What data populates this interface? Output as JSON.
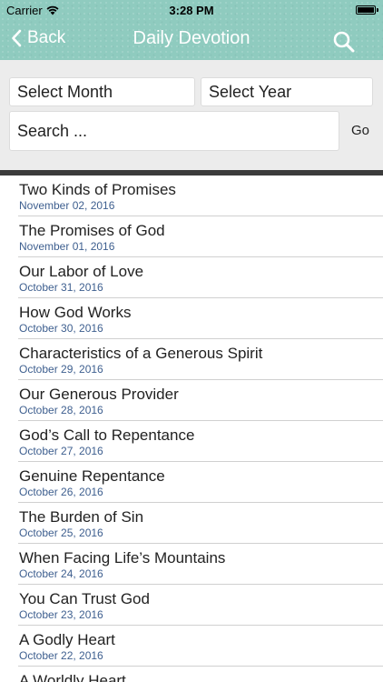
{
  "status_bar": {
    "carrier": "Carrier",
    "time": "3:28 PM",
    "battery_level": 1.0
  },
  "nav": {
    "back_label": "Back",
    "title": "Daily Devotion",
    "search_icon": "magnifier-icon"
  },
  "filters": {
    "month_label": "Select Month",
    "year_label": "Select Year",
    "search_placeholder": "Search ...",
    "go_label": "Go"
  },
  "devotions": [
    {
      "title": "Two Kinds of Promises",
      "date": "November 02, 2016"
    },
    {
      "title": "The Promises of God",
      "date": "November 01, 2016"
    },
    {
      "title": "Our Labor of Love",
      "date": "October 31, 2016"
    },
    {
      "title": "How God Works",
      "date": "October 30, 2016"
    },
    {
      "title": "Characteristics of a Generous Spirit",
      "date": "October 29, 2016"
    },
    {
      "title": "Our Generous Provider",
      "date": "October 28, 2016"
    },
    {
      "title": "God’s Call to Repentance",
      "date": "October 27, 2016"
    },
    {
      "title": "Genuine Repentance",
      "date": "October 26, 2016"
    },
    {
      "title": "The Burden of Sin",
      "date": "October 25, 2016"
    },
    {
      "title": "When Facing Life’s Mountains",
      "date": "October 24, 2016"
    },
    {
      "title": "You Can Trust God",
      "date": "October 23, 2016"
    },
    {
      "title": "A Godly Heart",
      "date": "October 22, 2016"
    },
    {
      "title": "A Worldly Heart",
      "date": ""
    }
  ],
  "colors": {
    "header": "#8fcbbf",
    "panel": "#ececec",
    "divider": "#3b3b3b",
    "date_text": "#3e5f8f"
  }
}
